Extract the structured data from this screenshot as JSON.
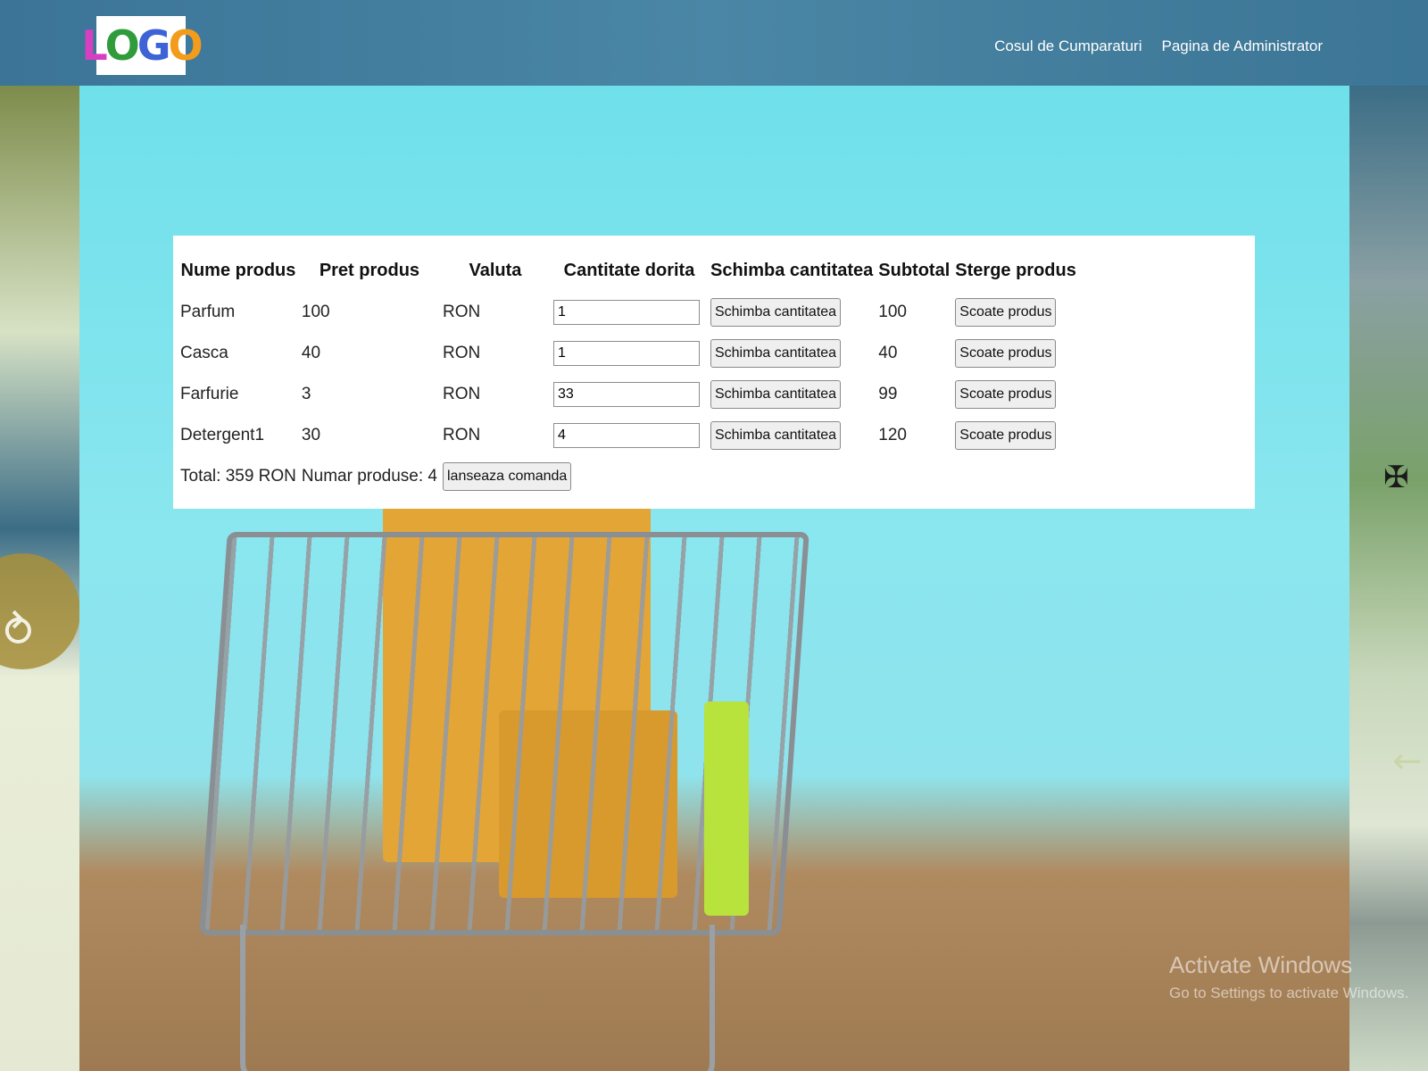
{
  "header": {
    "logo": [
      "L",
      "O",
      "G",
      "O"
    ],
    "nav": [
      {
        "label": "Cosul de Cumparaturi"
      },
      {
        "label": "Pagina de Administrator"
      }
    ]
  },
  "cart": {
    "columns": [
      "Nume produs",
      "Pret produs",
      "Valuta",
      "Cantitate dorita",
      "Schimba cantitatea",
      "Subtotal",
      "Sterge produs"
    ],
    "rows": [
      {
        "name": "Parfum",
        "price": "100",
        "currency": "RON",
        "quantity": "1",
        "change_label": "Schimba cantitatea",
        "subtotal": "100",
        "remove_label": "Scoate produs"
      },
      {
        "name": "Casca",
        "price": "40",
        "currency": "RON",
        "quantity": "1",
        "change_label": "Schimba cantitatea",
        "subtotal": "40",
        "remove_label": "Scoate produs"
      },
      {
        "name": "Farfurie",
        "price": "3",
        "currency": "RON",
        "quantity": "33",
        "change_label": "Schimba cantitatea",
        "subtotal": "99",
        "remove_label": "Scoate produs"
      },
      {
        "name": "Detergent1",
        "price": "30",
        "currency": "RON",
        "quantity": "4",
        "change_label": "Schimba cantitatea",
        "subtotal": "120",
        "remove_label": "Scoate produs"
      }
    ],
    "total": "Total: 359 RON",
    "item_count": "Numar produse: 4",
    "order_button": "lanseaza comanda"
  },
  "watermark": {
    "title": "Activate Windows",
    "subtitle": "Go to Settings to activate Windows."
  }
}
